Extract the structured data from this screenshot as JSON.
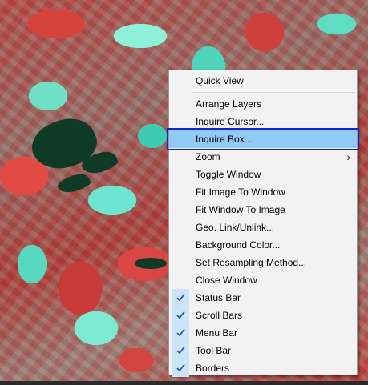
{
  "context_menu": {
    "items": [
      {
        "label": "Quick View",
        "checked": false,
        "submenu": false,
        "highlighted": false
      },
      {
        "separator": true
      },
      {
        "label": "Arrange Layers",
        "checked": false,
        "submenu": false,
        "highlighted": false
      },
      {
        "label": "Inquire Cursor...",
        "checked": false,
        "submenu": false,
        "highlighted": false
      },
      {
        "label": "Inquire Box...",
        "checked": false,
        "submenu": false,
        "highlighted": true
      },
      {
        "label": "Zoom",
        "checked": false,
        "submenu": true,
        "highlighted": false
      },
      {
        "label": "Toggle Window",
        "checked": false,
        "submenu": false,
        "highlighted": false
      },
      {
        "label": "Fit Image To Window",
        "checked": false,
        "submenu": false,
        "highlighted": false
      },
      {
        "label": "Fit Window To Image",
        "checked": false,
        "submenu": false,
        "highlighted": false
      },
      {
        "label": "Geo. Link/Unlink...",
        "checked": false,
        "submenu": false,
        "highlighted": false
      },
      {
        "label": "Background Color...",
        "checked": false,
        "submenu": false,
        "highlighted": false
      },
      {
        "label": "Set Resampling Method...",
        "checked": false,
        "submenu": false,
        "highlighted": false
      },
      {
        "label": "Close Window",
        "checked": false,
        "submenu": false,
        "highlighted": false
      },
      {
        "label": "Status Bar",
        "checked": true,
        "submenu": false,
        "highlighted": false
      },
      {
        "label": "Scroll Bars",
        "checked": true,
        "submenu": false,
        "highlighted": false
      },
      {
        "label": "Menu Bar",
        "checked": true,
        "submenu": false,
        "highlighted": false
      },
      {
        "label": "Tool Bar",
        "checked": true,
        "submenu": false,
        "highlighted": false
      },
      {
        "label": "Borders",
        "checked": true,
        "submenu": false,
        "highlighted": false
      }
    ]
  },
  "colors": {
    "menu_background": "#f2f2f2",
    "highlight_fill": "#91c9f7",
    "highlight_border": "#1126c9",
    "check_background": "#cce4f7"
  },
  "icons": {
    "check": "checkmark-icon",
    "submenu": "chevron-right-icon"
  }
}
